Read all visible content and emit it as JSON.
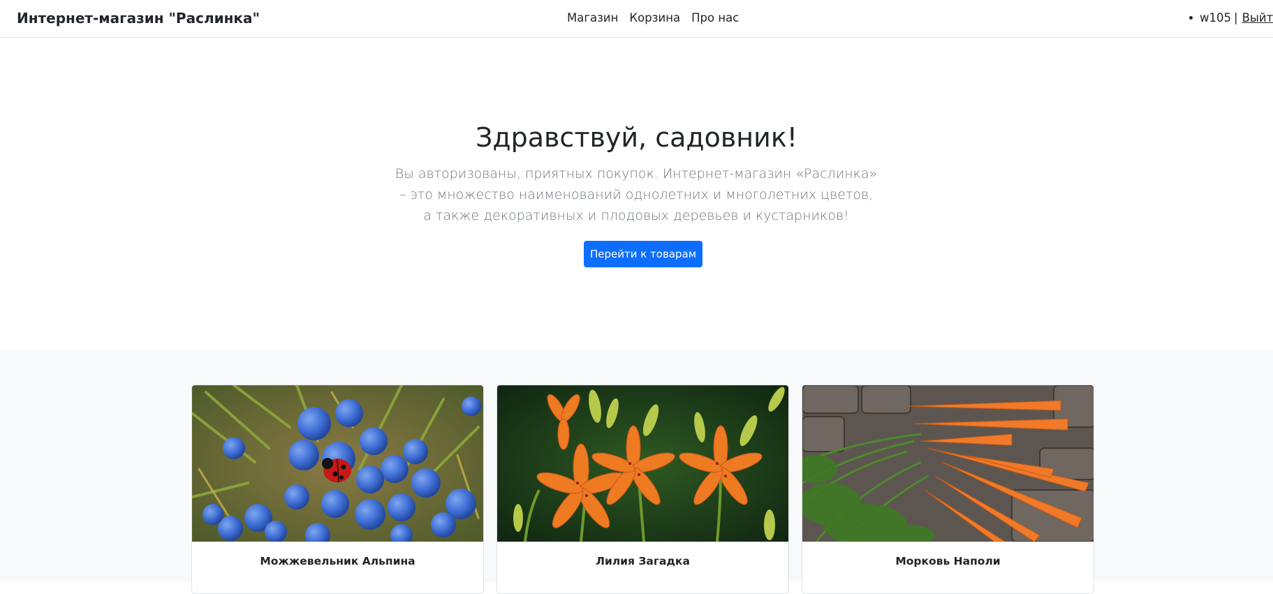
{
  "navbar": {
    "brand": "Интернет-магазин \"Раслинка\"",
    "links": [
      "Магазин",
      "Корзина",
      "Про нас"
    ],
    "username": "w105",
    "separator": "|",
    "logout": "Выйти"
  },
  "hero": {
    "title": "Здравствуй, садовник!",
    "lead_lines": [
      "Вы авторизованы, приятных покупок. Интернет-магазин «Раслинка»",
      "– это множество наименований однолетних и многолетних цветов,",
      "а также декоративных и плодовых деревьев и кустарников!"
    ],
    "cta_label": "Перейти к товарам"
  },
  "products": [
    {
      "title": "Можжевельник Альпина",
      "image": "juniper-berries-photo"
    },
    {
      "title": "Лилия Загадка",
      "image": "orange-lily-photo"
    },
    {
      "title": "Морковь Наполи",
      "image": "carrots-photo"
    }
  ],
  "colors": {
    "primary": "#0d6efd",
    "muted_text": "#6c757d",
    "section_bg": "#f8f9fa",
    "border": "#dee2e6"
  }
}
